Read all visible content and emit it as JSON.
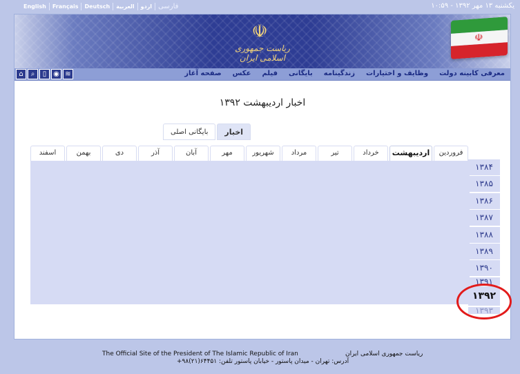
{
  "topbar": {
    "languages": [
      "English",
      "Français",
      "Deutsch",
      "العربية",
      "اردو",
      "فارسی"
    ],
    "datetime": "یکشنبه ۱۳ مهر ۱۳۹۲ - ۱۰:۵۹"
  },
  "banner": {
    "emblem_title": "ریاست جمهوری اسلامی ایران"
  },
  "nav": {
    "items": [
      "صفحه آغاز",
      "عکس",
      "فیلم",
      "بایگانی",
      "زندگینامه",
      "وظایف و اختیارات",
      "معرفی کابینه دولت"
    ],
    "icons": [
      "rss-icon",
      "podcast-icon",
      "mobile-icon",
      "search-icon",
      "home-icon"
    ]
  },
  "page": {
    "title": "اخبار اردیبهشت ۱۳۹۲"
  },
  "subtabs": [
    "اخبار",
    "بایگانی اصلی"
  ],
  "months": [
    "فروردین",
    "اردیبهشت",
    "خرداد",
    "تیر",
    "مرداد",
    "شهریور",
    "مهر",
    "آبان",
    "آذر",
    "دی",
    "بهمن",
    "اسفند"
  ],
  "years": [
    "۱۳۸۴",
    "۱۳۸۵",
    "۱۳۸۶",
    "۱۳۸۷",
    "۱۳۸۸",
    "۱۳۸۹",
    "۱۳۹۰",
    "۱۳۹۱",
    "۱۳۹۲",
    "۱۳۹۳"
  ],
  "footer": {
    "english": "The Official Site of the President of The Islamic Republic of Iran",
    "persian": "ریاست جمهوری اسلامی ایران",
    "address": "آدرس: تهران - میدان پاستور - خیابان پاستور تلفن: ۶۴۴۵۱(۲۱)۹۸+"
  }
}
